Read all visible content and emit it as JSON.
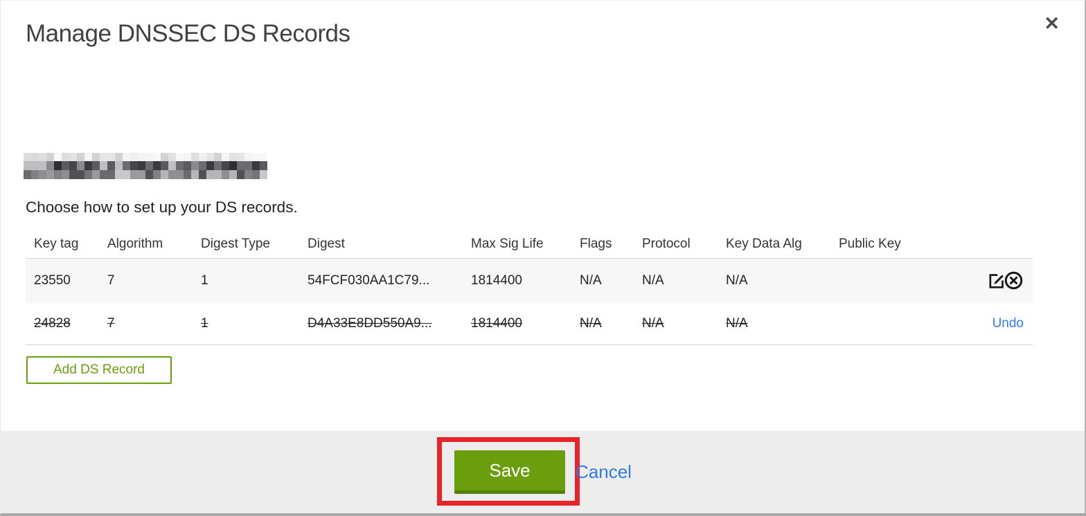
{
  "modal": {
    "title": "Manage DNSSEC DS Records",
    "close_glyph": "✕",
    "instruction": "Choose how to set up your DS records.",
    "table": {
      "columns": [
        "Key tag",
        "Algorithm",
        "Digest Type",
        "Digest",
        "Max Sig Life",
        "Flags",
        "Protocol",
        "Key Data Alg",
        "Public Key"
      ],
      "rows": [
        {
          "key_tag": "23550",
          "algorithm": "7",
          "digest_type": "1",
          "digest": "54FCF030AA1C79...",
          "max_sig_life": "1814400",
          "flags": "N/A",
          "protocol": "N/A",
          "key_data_alg": "N/A",
          "public_key": "",
          "state": "normal",
          "actions": [
            "edit",
            "delete"
          ]
        },
        {
          "key_tag": "24828",
          "algorithm": "7",
          "digest_type": "1",
          "digest": "D4A33E8DD550A9...",
          "max_sig_life": "1814400",
          "flags": "N/A",
          "protocol": "N/A",
          "key_data_alg": "N/A",
          "public_key": "",
          "state": "deleted",
          "undo_label": "Undo"
        }
      ]
    },
    "add_button_label": "Add DS Record",
    "footer": {
      "save_label": "Save",
      "cancel_label": "Cancel"
    }
  },
  "colors": {
    "accent_green": "#6b9e0d",
    "green_dark": "#557e0b",
    "link_blue": "#2e7ce5",
    "annotation_red": "#e8242a",
    "footer_bg": "#ededed",
    "row_alt_bg": "#f7f7f7",
    "border_gray": "#d5d5d5",
    "text_dark": "#222222",
    "title_gray": "#433f3f"
  },
  "redaction": {
    "rows": [
      [
        "#f4f4f4",
        "#e6e6e8",
        "#d9d9db",
        "#efefef",
        "#dedee0",
        "#f8f8f8",
        "#e2e2e4",
        "#d2d2d5"
      ],
      [
        "#2e2e33",
        "#45454b",
        "#5a5a60",
        "#3a3a3f",
        "#6b6b70",
        "#8a8a8f",
        "#bfbfc2",
        "#26262b"
      ],
      [
        "#808085",
        "#9a9a9e",
        "#b5b5b8",
        "#6a6a6f",
        "#505055",
        "#c8c8ca",
        "#8f8f93",
        "#737378"
      ]
    ]
  }
}
